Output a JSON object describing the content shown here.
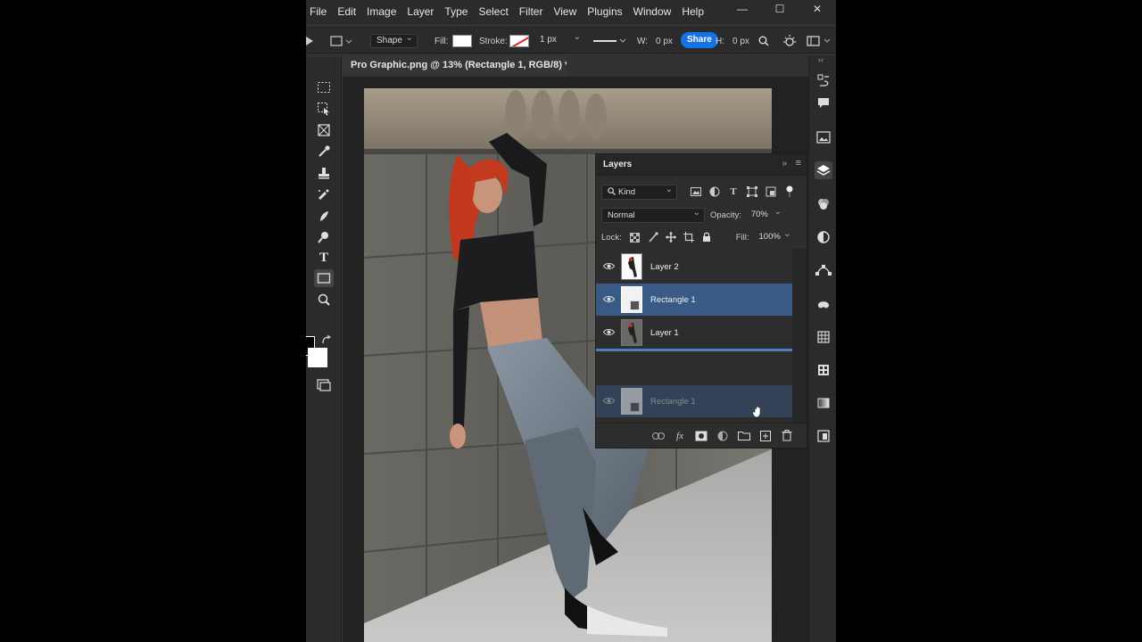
{
  "menu": [
    "File",
    "Edit",
    "Image",
    "Layer",
    "Type",
    "Select",
    "Filter",
    "View",
    "Plugins",
    "Window",
    "Help"
  ],
  "window_controls": {
    "minimize": "—",
    "maximize": "☐",
    "close": "✕"
  },
  "options_bar": {
    "shape_mode": "Shape",
    "fill_label": "Fill:",
    "stroke_label": "Stroke:",
    "stroke_width": "1 px",
    "w_label": "W:",
    "w_value": "0 px",
    "share": "Share",
    "h_label": "H:",
    "h_value": "0 px"
  },
  "document_tab": {
    "title": "Pro Graphic.png @ 13% (Rectangle 1, RGB/8) *",
    "close": "×"
  },
  "layers_panel": {
    "title": "Layers",
    "filter_kind": "Kind",
    "blend_mode": "Normal",
    "opacity_label": "Opacity:",
    "opacity_value": "70%",
    "lock_label": "Lock:",
    "fill_label": "Fill:",
    "fill_value": "100%",
    "layers": [
      {
        "name": "Layer 2",
        "selected": false
      },
      {
        "name": "Rectangle 1",
        "selected": true
      },
      {
        "name": "Layer 1",
        "selected": false
      }
    ],
    "dragging_layer": "Rectangle 1"
  },
  "colors": {
    "accent": "#1473e6",
    "selection": "#3a5a86",
    "panel_bg": "#2d2d2d",
    "app_bg": "#323232"
  }
}
